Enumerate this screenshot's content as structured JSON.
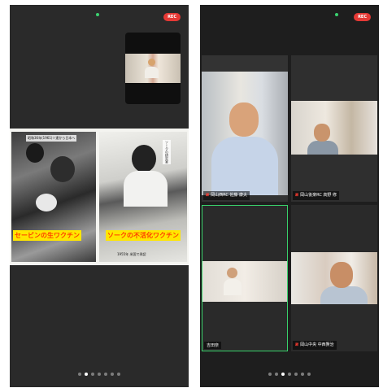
{
  "left_screen": {
    "rec_label": "REC",
    "shared_content": {
      "left_photo": {
        "top_caption": "昭和36年(1961)ソ連から日本へ",
        "yellow_caption": "セービンの生ワクチン"
      },
      "right_photo": {
        "top_caption": "ソークの研究室",
        "yellow_caption": "ソークの不活化ワクチン",
        "bottom_caption": "1955年 米国で承認"
      }
    },
    "page_count": 7,
    "active_page_index": 1
  },
  "right_screen": {
    "rec_label": "REC",
    "participants": [
      {
        "name": "岡山西RC 佐藤 康夫",
        "muted": true
      },
      {
        "name": "岡山後楽RC 高野 修",
        "muted": true
      },
      {
        "name": "吉田奈",
        "muted": false,
        "active_speaker": true
      },
      {
        "name": "岡山中央 中西賢治",
        "muted": true
      }
    ],
    "page_count": 7,
    "active_page_index": 2
  },
  "colors": {
    "rec_red": "#e53935",
    "active_speaker_border": "#39d26b",
    "caption_highlight": "#ffe600",
    "caption_text": "#ff3d00"
  }
}
